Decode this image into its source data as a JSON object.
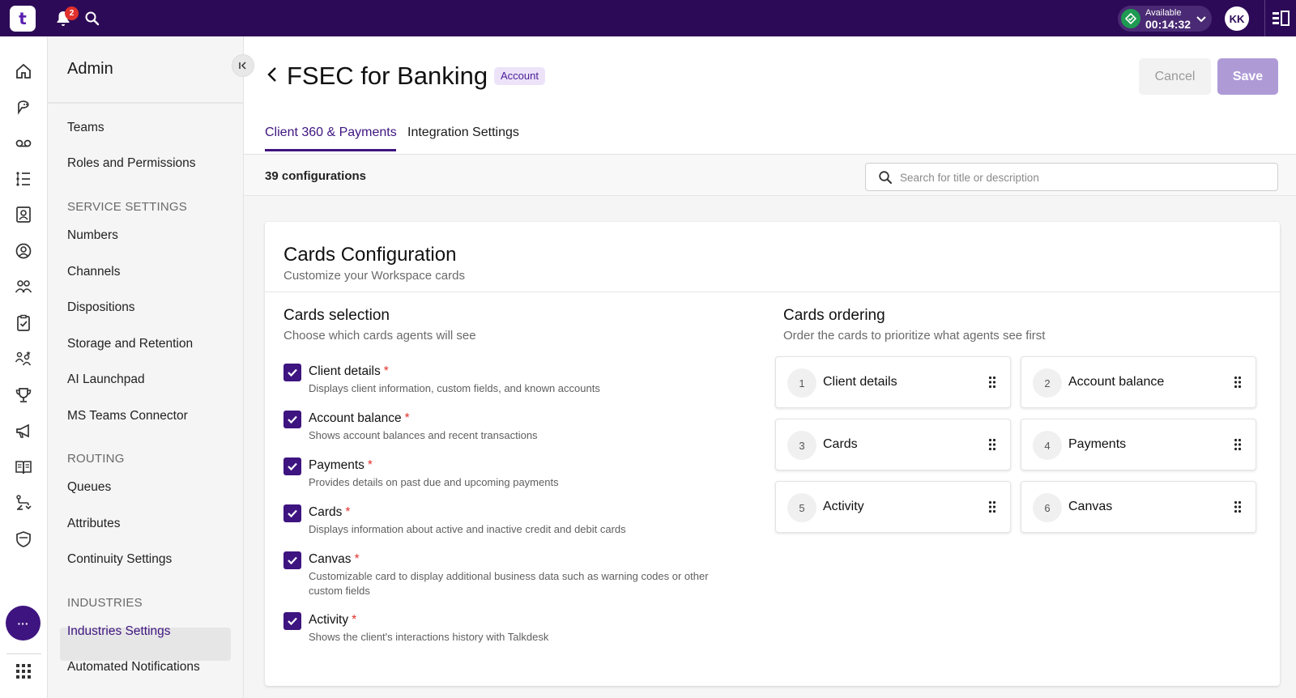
{
  "topbar": {
    "logo_text": "t",
    "notification_count": "2",
    "status": {
      "label": "Available",
      "timer": "00:14:32",
      "color": "#1e9a52"
    },
    "avatar_initials": "KK"
  },
  "colors": {
    "brand_dark": "#2d0a57",
    "accent": "#3e1480",
    "required": "#e0312d"
  },
  "rail": {
    "icons": [
      "home-icon",
      "conversations-icon",
      "voicemail-icon",
      "list-icon",
      "contacts-icon",
      "agent-icon",
      "team-icon",
      "clipboard-icon",
      "users-star-icon",
      "trophy-icon",
      "megaphone-icon",
      "book-icon",
      "routing-icon",
      "shield-icon"
    ],
    "more_label": "···",
    "apps_icon": "grid-icon"
  },
  "sidebar": {
    "title": "Admin",
    "items_top": [
      "Teams",
      "Roles and Permissions"
    ],
    "sections": [
      {
        "title": "SERVICE SETTINGS",
        "items": [
          "Numbers",
          "Channels",
          "Dispositions",
          "Storage and Retention",
          "AI Launchpad",
          "MS Teams Connector"
        ]
      },
      {
        "title": "ROUTING",
        "items": [
          "Queues",
          "Attributes",
          "Continuity Settings"
        ]
      },
      {
        "title": "INDUSTRIES",
        "items": [
          "Industries Settings",
          "Automated Notifications"
        ]
      }
    ],
    "active_item": "Industries Settings"
  },
  "header": {
    "title": "FSEC for Banking",
    "badge": "Account",
    "cancel_label": "Cancel",
    "save_label": "Save",
    "tabs": [
      "Client 360 & Payments",
      "Integration Settings"
    ],
    "active_tab": "Client 360 & Payments"
  },
  "config_bar": {
    "count": "39 configurations",
    "search_placeholder": "Search for title or description"
  },
  "card": {
    "title": "Cards Configuration",
    "subtitle": "Customize your Workspace cards",
    "selection": {
      "title": "Cards selection",
      "subtitle": "Choose which cards agents will see",
      "items": [
        {
          "label": "Client details",
          "desc": "Displays client information, custom fields, and known accounts",
          "checked": true,
          "required": "*"
        },
        {
          "label": "Account balance",
          "desc": "Shows account balances and recent transactions",
          "checked": true,
          "required": "*"
        },
        {
          "label": "Payments",
          "desc": "Provides details on past due and upcoming payments",
          "checked": true,
          "required": "*"
        },
        {
          "label": "Cards",
          "desc": "Displays information about active and inactive credit and debit cards",
          "checked": true,
          "required": "*"
        },
        {
          "label": "Canvas",
          "desc": "Customizable card to display additional business data such as warning codes or other custom fields",
          "checked": true,
          "required": "*"
        },
        {
          "label": "Activity",
          "desc": "Shows the client's interactions history with Talkdesk",
          "checked": true,
          "required": "*"
        }
      ]
    },
    "ordering": {
      "title": "Cards ordering",
      "subtitle": "Order the cards to prioritize what agents see first",
      "items": [
        {
          "num": "1",
          "label": "Client details"
        },
        {
          "num": "2",
          "label": "Account balance"
        },
        {
          "num": "3",
          "label": "Cards"
        },
        {
          "num": "4",
          "label": "Payments"
        },
        {
          "num": "5",
          "label": "Activity"
        },
        {
          "num": "6",
          "label": "Canvas"
        }
      ]
    }
  }
}
